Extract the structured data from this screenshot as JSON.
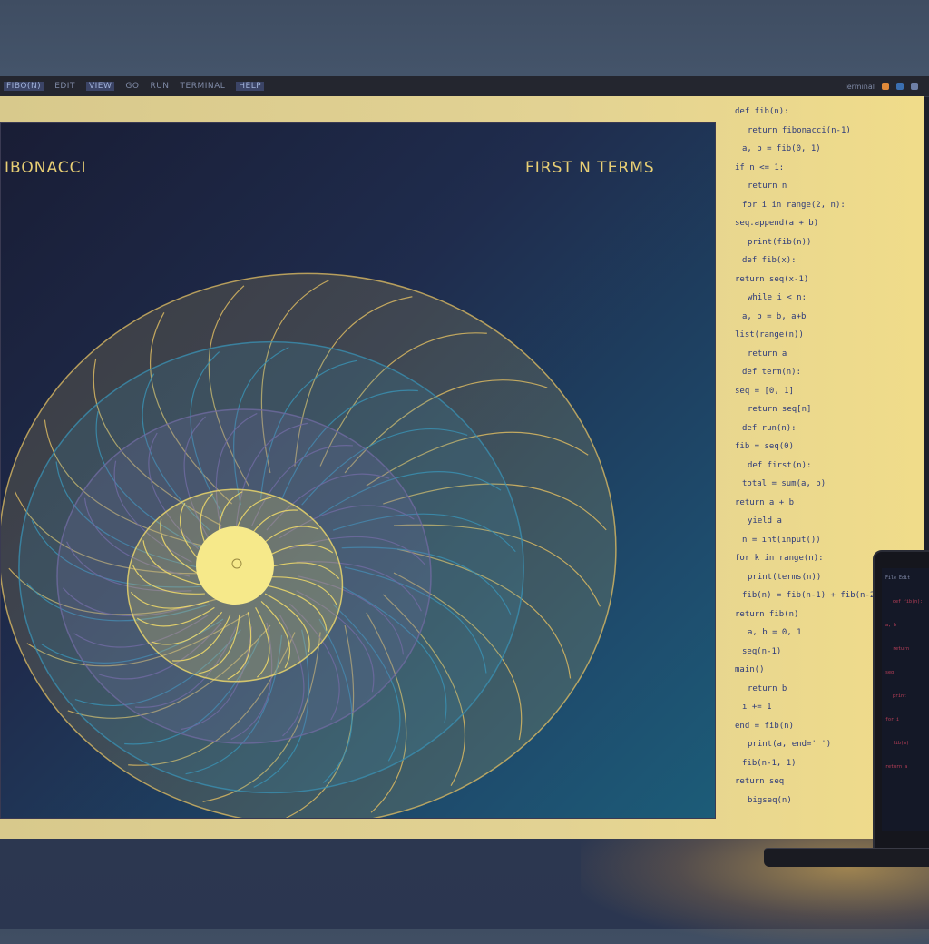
{
  "window": {
    "menu": [
      "FIBO(N)",
      "EDIT",
      "VIEW",
      "GO",
      "RUN",
      "TERMINAL",
      "HELP"
    ],
    "status": "Terminal",
    "status_dots": [
      "#e08a3a",
      "#3b6fb0",
      "#6e7fa6"
    ]
  },
  "canvas": {
    "title_left": "IBONACCI",
    "title_right": "FIRST N TERMS",
    "accent": "#e8cf74",
    "spiral_colors": [
      "#f2dc6a",
      "#d9b962",
      "#6f6aa0",
      "#3a8fb0",
      "#2a6f9a"
    ]
  },
  "code": {
    "lines": [
      "def fib(n):",
      "  return fibonacci(n-1)",
      "    a, b = fib(0, 1)",
      "  if n <= 1:",
      "    return n",
      "  for i in range(2, n):",
      "    seq.append(a + b)",
      "  print(fib(n))",
      "def fib(x):",
      "  return seq(x-1)",
      "  while i < n:",
      "    a, b = b, a+b",
      "  list(range(n))",
      "  return a",
      "def term(n):",
      "  seq = [0, 1]",
      "  return seq[n]",
      "def run(n):",
      "  fib = seq(0)",
      "def first(n):",
      "  total = sum(a, b)",
      "  return a + b",
      "  yield a",
      "  n = int(input())",
      "  for k in range(n):",
      "  print(terms(n))",
      "  fib(n) = fib(n-1) + fib(n-2)",
      "  return fib(n)",
      "  a, b = 0, 1",
      "  seq(n-1)",
      "  main()",
      "  return b",
      "  i += 1",
      "  end = fib(n)",
      "  print(a, end=' ')",
      "  fib(n-1, 1)",
      "  return seq",
      "bigseq(n)"
    ]
  },
  "laptop": {
    "lines": [
      "File  Edit",
      "def fib(n):",
      "  a, b",
      "  return",
      "  seq",
      "  print",
      "  for i",
      "  fib(n)",
      "  return a"
    ]
  }
}
